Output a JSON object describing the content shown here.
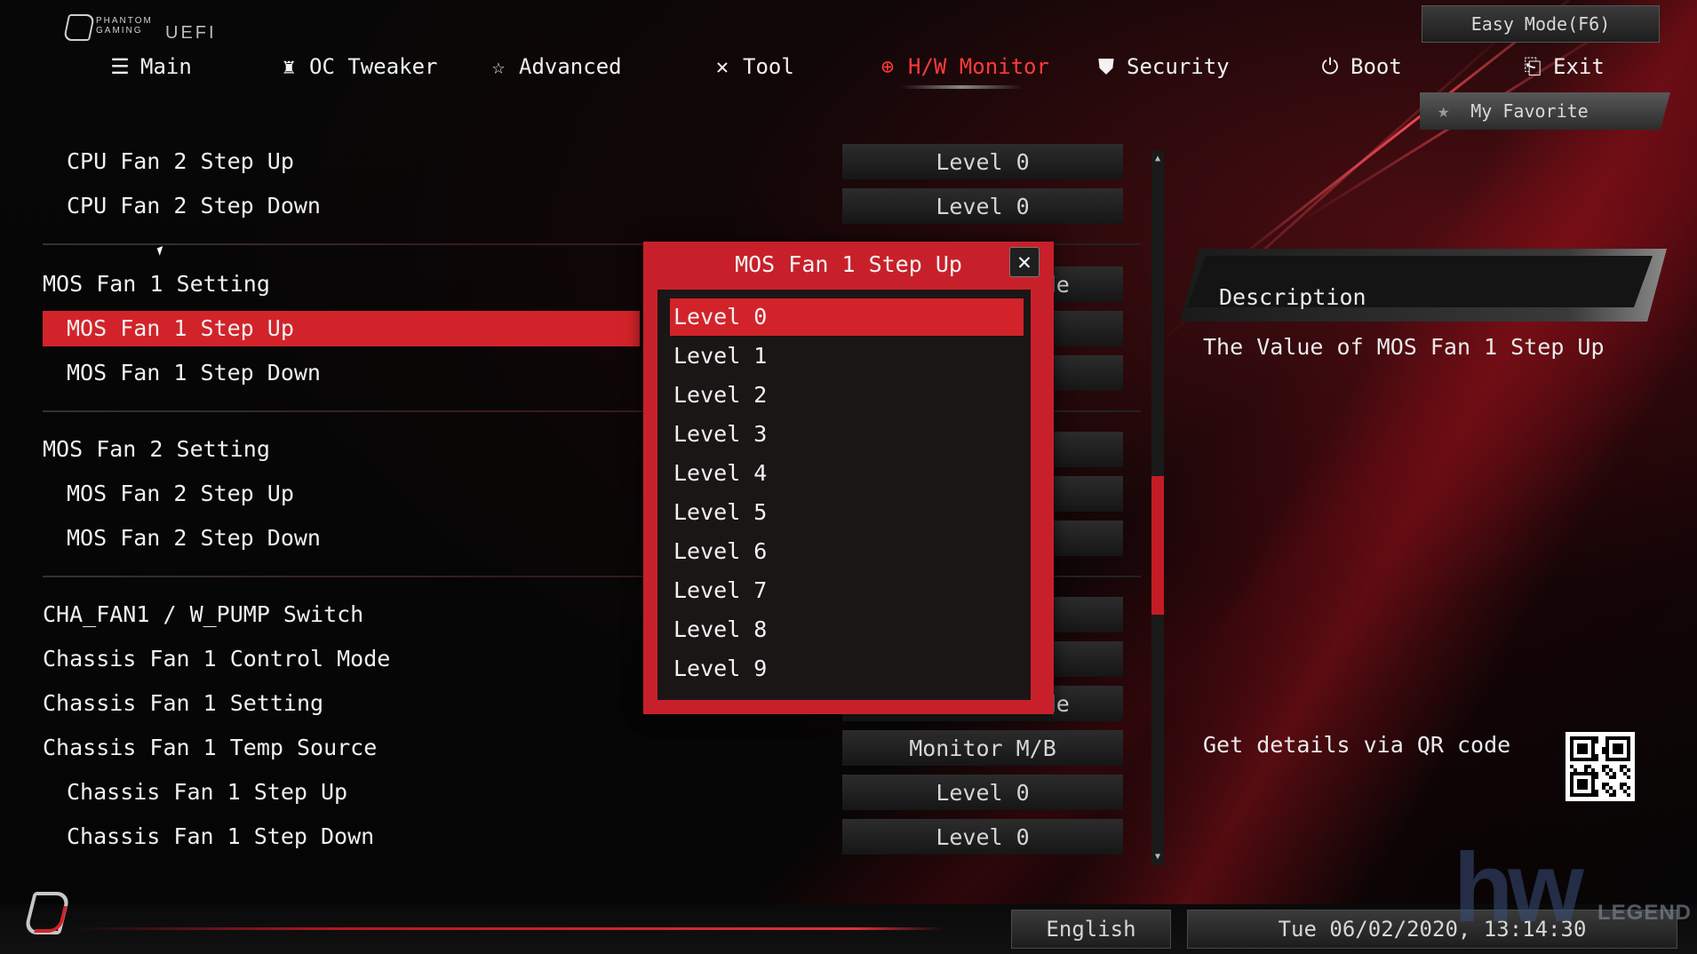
{
  "brand": {
    "logo_text": "PHANTOM GAMING",
    "product": "UEFI"
  },
  "header": {
    "easy_mode_label": "Easy Mode(F6)",
    "favorite_label": "My Favorite"
  },
  "nav": {
    "active": "H/W Monitor",
    "items": [
      {
        "label": "Main",
        "icon": "list-icon"
      },
      {
        "label": "OC Tweaker",
        "icon": "rocket-icon"
      },
      {
        "label": "Advanced",
        "icon": "star-icon"
      },
      {
        "label": "Tool",
        "icon": "tools-icon"
      },
      {
        "label": "H/W Monitor",
        "icon": "monitor-icon"
      },
      {
        "label": "Security",
        "icon": "shield-icon"
      },
      {
        "label": "Boot",
        "icon": "power-icon"
      },
      {
        "label": "Exit",
        "icon": "exit-icon"
      }
    ]
  },
  "settings": [
    {
      "label": "CPU Fan 2 Step Up",
      "value": "Level 0",
      "sub": true
    },
    {
      "label": "CPU Fan 2 Step Down",
      "value": "Level 0",
      "sub": true
    },
    {
      "label": "MOS Fan 1 Setting",
      "value": "Standard Mode",
      "sub": false
    },
    {
      "label": "MOS Fan 1 Step Up",
      "value": "",
      "sub": true,
      "selected": true
    },
    {
      "label": "MOS Fan 1 Step Down",
      "value": "",
      "sub": true
    },
    {
      "label": "MOS Fan 2 Setting",
      "value": "",
      "sub": false
    },
    {
      "label": "MOS Fan 2 Step Up",
      "value": "",
      "sub": true
    },
    {
      "label": "MOS Fan 2 Step Down",
      "value": "",
      "sub": true
    },
    {
      "label": "CHA_FAN1 / W_PUMP Switch",
      "value": "",
      "sub": false
    },
    {
      "label": "Chassis Fan 1 Control Mode",
      "value": "",
      "sub": false
    },
    {
      "label": "Chassis Fan 1 Setting",
      "value": "Standard Mode",
      "sub": false
    },
    {
      "label": "Chassis Fan 1 Temp Source",
      "value": "Monitor M/B",
      "sub": false
    },
    {
      "label": "Chassis Fan 1 Step Up",
      "value": "Level 0",
      "sub": true
    },
    {
      "label": "Chassis Fan 1 Step Down",
      "value": "Level 0",
      "sub": true
    }
  ],
  "modal": {
    "title": "MOS Fan 1 Step Up",
    "selected": "Level 0",
    "options": [
      "Level 0",
      "Level 1",
      "Level 2",
      "Level 3",
      "Level 4",
      "Level 5",
      "Level 6",
      "Level 7",
      "Level 8",
      "Level 9"
    ]
  },
  "description": {
    "title": "Description",
    "text": "The Value of MOS Fan 1 Step Up",
    "qr_label": "Get details via QR code"
  },
  "footer": {
    "language": "English",
    "datetime": "Tue 06/02/2020, 13:14:30"
  },
  "watermark": {
    "text": "hw",
    "subtext": "LEGEND"
  },
  "colors": {
    "accent": "#d2232a",
    "active_nav": "#ff3b3b",
    "panel": "#1b1616"
  }
}
